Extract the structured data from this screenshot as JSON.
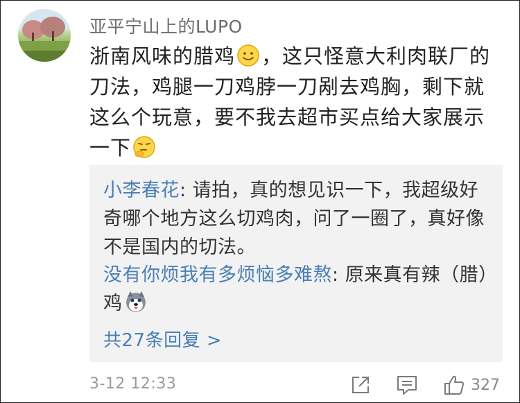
{
  "comment": {
    "username": "亚平宁山上的LUPO",
    "text_part1": "浙南风味的腊鸡",
    "text_part2": "，这只怪意大利肉联厂的刀法，鸡腿一刀鸡脖一刀剐去鸡胸，剩下就这么个玩意，要不我去超市买点给大家展示一下",
    "emoji_1": "smile-emoji",
    "emoji_2": "thinking-emoji",
    "timestamp": "3-12 12:33",
    "like_count": "327"
  },
  "replies": [
    {
      "username": "小李春花",
      "separator": ": ",
      "text": "请拍，真的想见识一下，我超级好奇哪个地方这么切鸡肉，问了一圈了，真好像不是国内的切法。"
    },
    {
      "username": "没有你烦我有多烦恼多难熬",
      "separator": ": ",
      "text": "原来真有辣（腊）鸡",
      "emoji": "husky-emoji"
    }
  ],
  "more_replies_label": "共27条回复 >",
  "icons": {
    "share": "share-icon",
    "comment": "comment-icon",
    "like": "thumbs-up-icon"
  },
  "colors": {
    "username_link": "#4a7fb6",
    "reply_background": "#f2f2f2",
    "meta_gray": "#999999"
  }
}
